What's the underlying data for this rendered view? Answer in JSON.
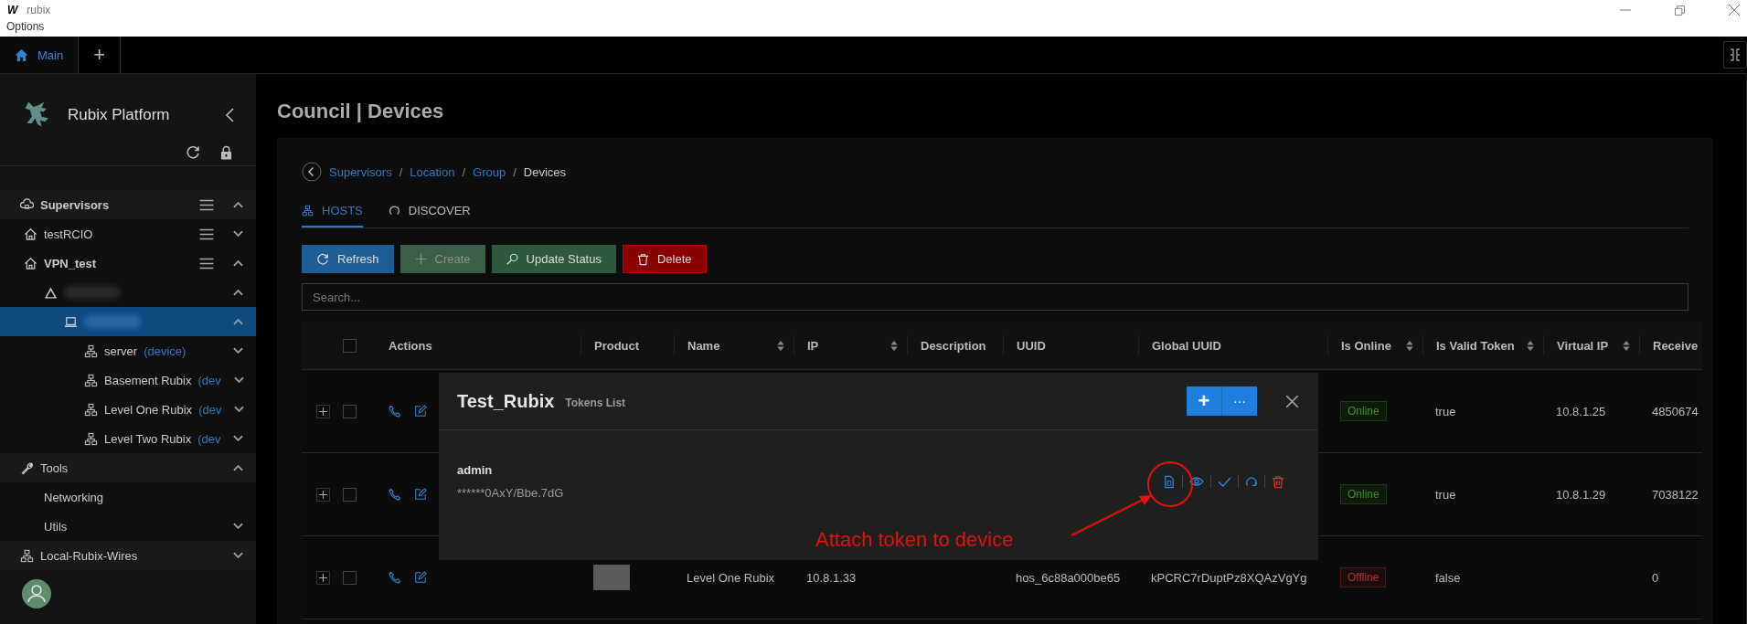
{
  "window": {
    "icon_text": "W",
    "title": "rubix",
    "menu": [
      "Options"
    ]
  },
  "app_tabs": [
    {
      "label": "Main",
      "selected": true,
      "kind": "home"
    },
    {
      "label": "+",
      "selected": false,
      "kind": "add"
    }
  ],
  "sidebar": {
    "brand": "Rubix Platform",
    "tree": [
      {
        "label": "Supervisors",
        "kind": "supervisors",
        "bold": true,
        "menu": true,
        "expanded": true,
        "selected": false,
        "children": [
          {
            "label": "testRCIO",
            "kind": "location",
            "bold": false,
            "menu": true,
            "expanded": false,
            "selected": false
          },
          {
            "label": "VPN_test",
            "kind": "location",
            "bold": true,
            "menu": true,
            "expanded": true,
            "selected": false,
            "children": [
              {
                "kind": "group",
                "redacted": true,
                "menu": false,
                "expanded": true,
                "selected": false,
                "children": [
                  {
                    "kind": "host",
                    "redacted": true,
                    "menu": false,
                    "expanded": true,
                    "selected": true,
                    "children": [
                      {
                        "label": "server",
                        "suffix": "(device)",
                        "kind": "device",
                        "bold": false,
                        "menu": false,
                        "expanded": false,
                        "selected": false
                      },
                      {
                        "label": "Basement Rubix",
                        "suffix": "(dev",
                        "kind": "device",
                        "bold": false,
                        "menu": false,
                        "expanded": false,
                        "selected": false
                      },
                      {
                        "label": "Level One Rubix",
                        "suffix": "(dev",
                        "kind": "device",
                        "bold": false,
                        "menu": false,
                        "expanded": false,
                        "selected": false
                      },
                      {
                        "label": "Level Two Rubix",
                        "suffix": "(dev",
                        "kind": "device",
                        "bold": false,
                        "menu": false,
                        "expanded": false,
                        "selected": false
                      }
                    ]
                  }
                ]
              }
            ]
          }
        ]
      },
      {
        "label": "Tools",
        "kind": "tools",
        "bold": false,
        "menu": false,
        "expanded": true,
        "selected": false,
        "children": [
          {
            "label": "Networking",
            "kind": "page",
            "bold": false,
            "menu": false,
            "expanded": false,
            "selected": false
          },
          {
            "label": "Utils",
            "kind": "folder",
            "bold": false,
            "menu": false,
            "expanded": false,
            "selected": false
          }
        ]
      },
      {
        "label": "Local-Rubix-Wires",
        "kind": "wires",
        "bold": false,
        "menu": false,
        "expanded": false,
        "selected": false
      }
    ]
  },
  "page_title": "Council | Devices",
  "breadcrumb": [
    {
      "label": "Supervisors",
      "link": true
    },
    {
      "separator": "/",
      "label": "Location",
      "link": true
    },
    {
      "separator": "/",
      "label": "Group",
      "link": true
    },
    {
      "separator": "/",
      "label": "Devices",
      "link": false
    }
  ],
  "tabs": [
    {
      "label": "HOSTS",
      "kind": "hosts",
      "selected": true
    },
    {
      "label": "DISCOVER",
      "kind": "discover",
      "selected": false
    }
  ],
  "buttons": [
    {
      "label": "Refresh",
      "kind": "refresh",
      "disabled": false
    },
    {
      "label": "Create",
      "kind": "create",
      "disabled": true
    },
    {
      "label": "Update Status",
      "kind": "update",
      "disabled": false
    },
    {
      "label": "Delete",
      "kind": "delete",
      "disabled": false
    }
  ],
  "search": {
    "placeholder": "Search..."
  },
  "table": {
    "select_all_checked": false,
    "columns": [
      {
        "label": "Actions",
        "sortable": false
      },
      {
        "label": "Product",
        "sortable": false
      },
      {
        "label": "Name",
        "sortable": true
      },
      {
        "label": "IP",
        "sortable": true
      },
      {
        "label": "Description",
        "sortable": false
      },
      {
        "label": "UUID",
        "sortable": false
      },
      {
        "label": "Global UUID",
        "sortable": false
      },
      {
        "label": "Is Online",
        "sortable": true
      },
      {
        "label": "Is Valid Token",
        "sortable": true
      },
      {
        "label": "Virtual IP",
        "sortable": true
      },
      {
        "label": "Receive",
        "sortable": false
      }
    ],
    "rows": [
      {
        "checked": false,
        "status": {
          "label": "Online",
          "online": true
        },
        "valid_token": "true",
        "virtual_ip": "10.8.1.25",
        "received": "4850674"
      },
      {
        "checked": false,
        "status": {
          "label": "Online",
          "online": true
        },
        "valid_token": "true",
        "virtual_ip": "10.8.1.29",
        "received": "7038122"
      },
      {
        "checked": false,
        "product_image": true,
        "name": "Level One Rubix",
        "ip": "10.8.1.33",
        "uuid": "hos_6c88a000be65",
        "global_uuid": "kPCRC7rDuptPz8XQAzVgYg",
        "status": {
          "label": "Offline",
          "online": false
        },
        "valid_token": "false",
        "received": "0"
      }
    ]
  },
  "modal": {
    "title": "Test_Rubix",
    "subtitle": "Tokens List",
    "add_label": "+",
    "more_label": "···",
    "tokens": [
      {
        "name": "admin",
        "value": "******0AxY/Bbe.7dG",
        "actions": [
          {
            "kind": "attach"
          },
          {
            "kind": "view"
          },
          {
            "kind": "validate"
          },
          {
            "kind": "regenerate"
          },
          {
            "kind": "delete"
          }
        ]
      }
    ],
    "annotation": {
      "text": "Attach token to device"
    }
  }
}
